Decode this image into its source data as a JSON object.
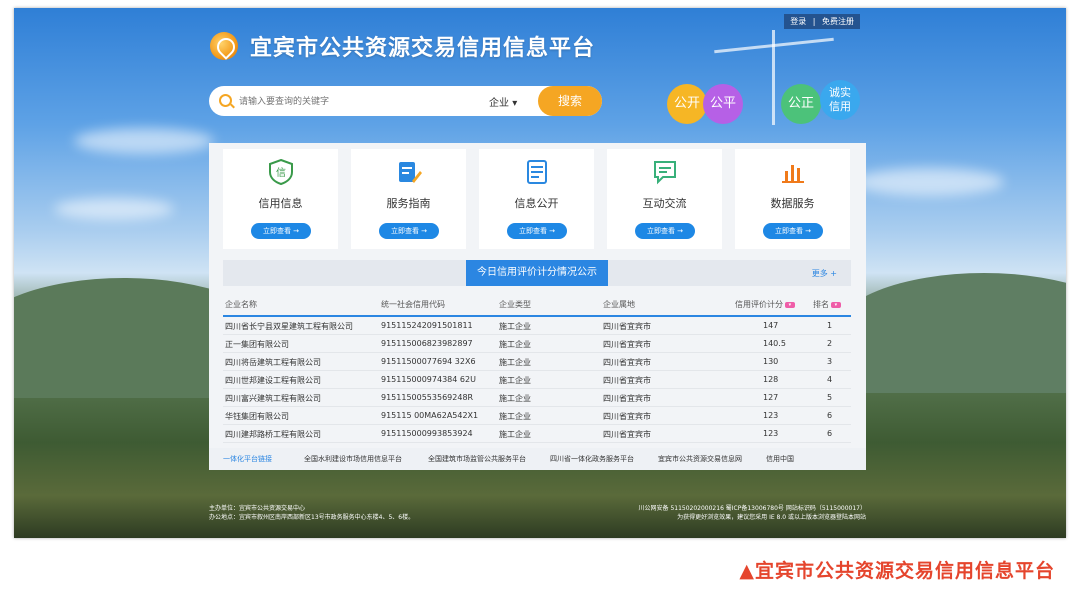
{
  "header": {
    "top_links": [
      "登录",
      "免费注册"
    ],
    "title": "宜宾市公共资源交易信用信息平台"
  },
  "search": {
    "placeholder": "请输入要查询的关键字",
    "category": "企业",
    "button": "搜索"
  },
  "badges": [
    {
      "text": "公开",
      "color": "#f6b625"
    },
    {
      "text": "公平",
      "color": "#b660e6"
    },
    {
      "text": "公正",
      "color": "#4cc27a"
    },
    {
      "text": "诚实信用",
      "color": "#3aa8ee"
    }
  ],
  "cards": [
    {
      "label": "信用信息",
      "button": "立即查看 →",
      "icon": "shield-credit-icon",
      "color": "#3a9a4a"
    },
    {
      "label": "服务指南",
      "button": "立即查看 →",
      "icon": "guide-edit-icon",
      "color": "#2a88e0"
    },
    {
      "label": "信息公开",
      "button": "立即查看 →",
      "icon": "document-list-icon",
      "color": "#2a88e0"
    },
    {
      "label": "互动交流",
      "button": "立即查看 →",
      "icon": "chat-bubble-icon",
      "color": "#38b07a"
    },
    {
      "label": "数据服务",
      "button": "立即查看 →",
      "icon": "bar-chart-icon",
      "color": "#f07a1a"
    }
  ],
  "table_section": {
    "tab": "今日信用评价计分情况公示",
    "more": "更多 +",
    "columns": [
      "企业名称",
      "统一社会信用代码",
      "企业类型",
      "企业属地",
      "信用评价计分",
      "排名"
    ],
    "rows": [
      [
        "四川省长宁县双星建筑工程有限公司",
        "915115242091501811",
        "施工企业",
        "四川省宜宾市",
        "147",
        "1"
      ],
      [
        "正一集团有限公司",
        "915115006823982897",
        "施工企业",
        "四川省宜宾市",
        "140.5",
        "2"
      ],
      [
        "四川将岳建筑工程有限公司",
        "91511500077694 32X6",
        "施工企业",
        "四川省宜宾市",
        "130",
        "3"
      ],
      [
        "四川世邦建设工程有限公司",
        "915115000974384 62U",
        "施工企业",
        "四川省宜宾市",
        "128",
        "4"
      ],
      [
        "四川富兴建筑工程有限公司",
        "91511500553569248R",
        "施工企业",
        "四川省宜宾市",
        "127",
        "5"
      ],
      [
        "华钰集团有限公司",
        "915115 00MA62A542X1",
        "施工企业",
        "四川省宜宾市",
        "123",
        "6"
      ],
      [
        "四川建邦路桥工程有限公司",
        "915115000993853924",
        "施工企业",
        "四川省宜宾市",
        "123",
        "6"
      ]
    ]
  },
  "links": [
    "一体化平台链接",
    "全国水利建设市场信用信息平台",
    "全国建筑市场监管公共服务平台",
    "四川省一体化政务服务平台",
    "宜宾市公共资源交易信息网",
    "信用中国"
  ],
  "footer": {
    "left1": "主办单位：宜宾市公共资源交易中心",
    "left2": "办公地点：宜宾市叙州区南岸西部新区13号市政务服务中心东楼4、5、6楼。",
    "right1": "川公网安备 51150202000216  蜀ICP备13006780号  网站标识码（5115000017）",
    "right2": "为获得更好浏览效果，建议您采用 IE 8.0 或以上版本浏览器登陆本网站"
  },
  "caption": "▲宜宾市公共资源交易信用信息平台"
}
